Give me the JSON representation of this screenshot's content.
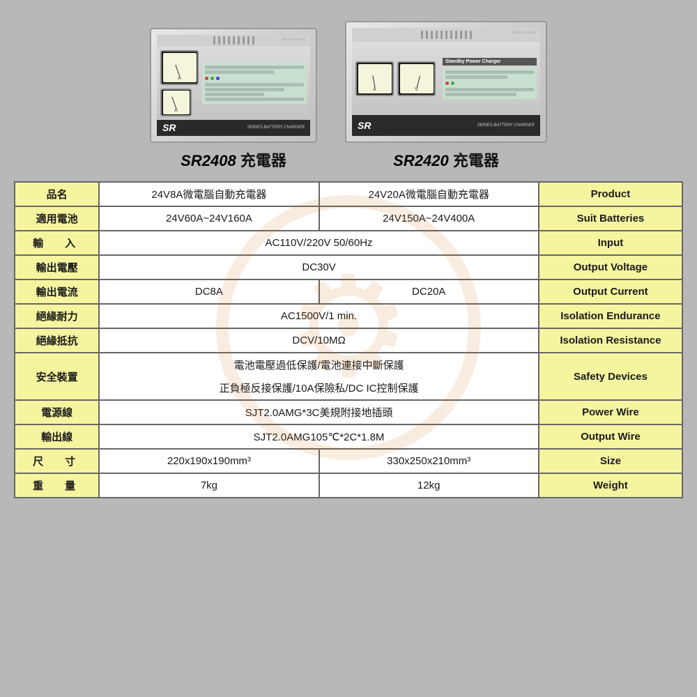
{
  "background_color": "#b8b8b8",
  "products": [
    {
      "id": "sr2408",
      "model": "SR2408",
      "title_suffix": "充電器"
    },
    {
      "id": "sr2420",
      "model": "SR2420",
      "title_suffix": "充電器"
    }
  ],
  "table": {
    "rows": [
      {
        "label_zh": "品名",
        "label_en": "Product",
        "sr2408_value": "24V8A微電腦自動充電器",
        "sr2420_value": "24V20A微電腦自動充電器",
        "combined": false
      },
      {
        "label_zh": "適用電池",
        "label_en": "Suit Batteries",
        "sr2408_value": "24V60A~24V160A",
        "sr2420_value": "24V150A~24V400A",
        "combined": false
      },
      {
        "label_zh": "輸　入",
        "label_en": "Input",
        "combined_value": "AC110V/220V  50/60Hz",
        "combined": true
      },
      {
        "label_zh": "輸出電壓",
        "label_en": "Output Voltage",
        "combined_value": "DC30V",
        "combined": true
      },
      {
        "label_zh": "輸出電流",
        "label_en": "Output Current",
        "sr2408_value": "DC8A",
        "sr2420_value": "DC20A",
        "combined": false
      },
      {
        "label_zh": "絕緣耐力",
        "label_en": "Isolation Endurance",
        "combined_value": "AC1500V/1 min.",
        "combined": true
      },
      {
        "label_zh": "絕緣抵抗",
        "label_en": "Isolation Resistance",
        "combined_value": "DCV/10MΩ",
        "combined": true
      },
      {
        "label_zh": "安全裝置",
        "label_en": "Safety Devices",
        "combined_value": "電池電壓過低保護/電池連接中斷保護",
        "combined_value_2": "正負極反接保護/10A保險私/DC  IC控制保護",
        "combined": true,
        "two_lines": true
      },
      {
        "label_zh": "電源線",
        "label_en": "Power Wire",
        "combined_value": "SJT2.0AMG*3C美規附接地插頭",
        "combined": true
      },
      {
        "label_zh": "輸出線",
        "label_en": "Output Wire",
        "combined_value": "SJT2.0AMG105℃*2C*1.8M",
        "combined": true
      },
      {
        "label_zh": "尺　寸",
        "label_en": "Size",
        "sr2408_value": "220x190x190mm³",
        "sr2420_value": "330x250x210mm³",
        "combined": false
      },
      {
        "label_zh": "重　量",
        "label_en": "Weight",
        "sr2408_value": "7kg",
        "sr2420_value": "12kg",
        "combined": false
      }
    ]
  }
}
